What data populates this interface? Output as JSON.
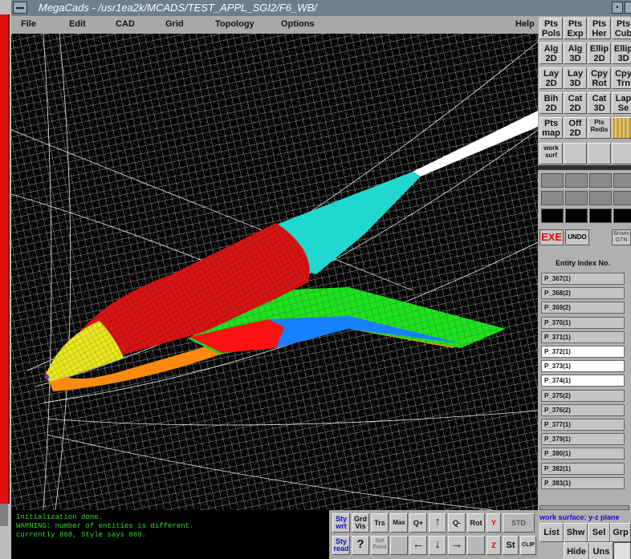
{
  "window": {
    "title": "MegaCads - /usr1ea2k/MCADS/TEST_APPL_SGI2/F6_WB/"
  },
  "menubar": {
    "items": [
      "File",
      "Edit",
      "CAD",
      "Grid",
      "Topology",
      "Options"
    ],
    "help": "Help"
  },
  "tool_buttons": [
    "Pts\nPols",
    "Pts\nExp",
    "Pts\nHer",
    "Pts\nCub",
    "Alg\n2D",
    "Alg\n3D",
    "Ellip\n2D",
    "Ellip\n3D",
    "Lay\n2D",
    "Lay\n3D",
    "Cpy\nRot",
    "Cpy\nTrn",
    "Bih\n2D",
    "Cat\n2D",
    "Cat\n3D",
    "Lap\nSe",
    "Pts\nmap",
    "Off\n2D",
    "Pts\nRedis",
    ""
  ],
  "work_surf_button": "work\nsurf",
  "exe_label": "EXE",
  "undo_label": "UNDO",
  "browse_label": "Brows\nGTN",
  "entity_header": "Entity Index No.",
  "entities": [
    {
      "label": "P_367(1)",
      "selected": false
    },
    {
      "label": "P_368(2)",
      "selected": false
    },
    {
      "label": "P_369(2)",
      "selected": false
    },
    {
      "label": "P_370(1)",
      "selected": false
    },
    {
      "label": "P_371(1)",
      "selected": false
    },
    {
      "label": "P_372(1)",
      "selected": true
    },
    {
      "label": "P_373(1)",
      "selected": true
    },
    {
      "label": "P_374(1)",
      "selected": true
    },
    {
      "label": "P_375(2)",
      "selected": false
    },
    {
      "label": "P_376(2)",
      "selected": false
    },
    {
      "label": "P_377(1)",
      "selected": false
    },
    {
      "label": "P_379(1)",
      "selected": false
    },
    {
      "label": "P_380(1)",
      "selected": false
    },
    {
      "label": "P_382(1)",
      "selected": false
    },
    {
      "label": "P_383(1)",
      "selected": false
    }
  ],
  "work_surface_label": "work surface: y-z plane",
  "right_bottom_buttons": {
    "list": "List",
    "shw": "Shw",
    "sel": "Sel",
    "grp": "Grp",
    "hide": "Hide",
    "uns": "Uns"
  },
  "console": {
    "lines": [
      "Initialization done.",
      "WARNING: number of entities is different.",
      "        currently 868, Style says 869."
    ]
  },
  "bottom_tools": {
    "sty_wrt": "Sty\nwrt",
    "grd_vis": "Grd\nVis",
    "trs": "Trs",
    "max": "Max",
    "zoom_in": "Q+",
    "up": "↑",
    "zoom_out": "Q-",
    "rot": "Rot",
    "std": "STD",
    "sty_read": "Sty\nread",
    "help": "?",
    "set_point": "Set\nPoint",
    "left": "←",
    "down": "↓",
    "right": "→",
    "st": "St",
    "clip": "CLIP"
  },
  "colors": {
    "fuselage": "#d81414",
    "nose": "#e8e820",
    "tail": "#20d8d0",
    "wing": "#20e020",
    "wing_red": "#ff1010",
    "wing_blue": "#1880ff",
    "underside": "#ff8a10",
    "grid": "#ffffff",
    "console_text": "#2fd92f"
  },
  "icons": [
    "menu-icon",
    "minimize-icon"
  ]
}
